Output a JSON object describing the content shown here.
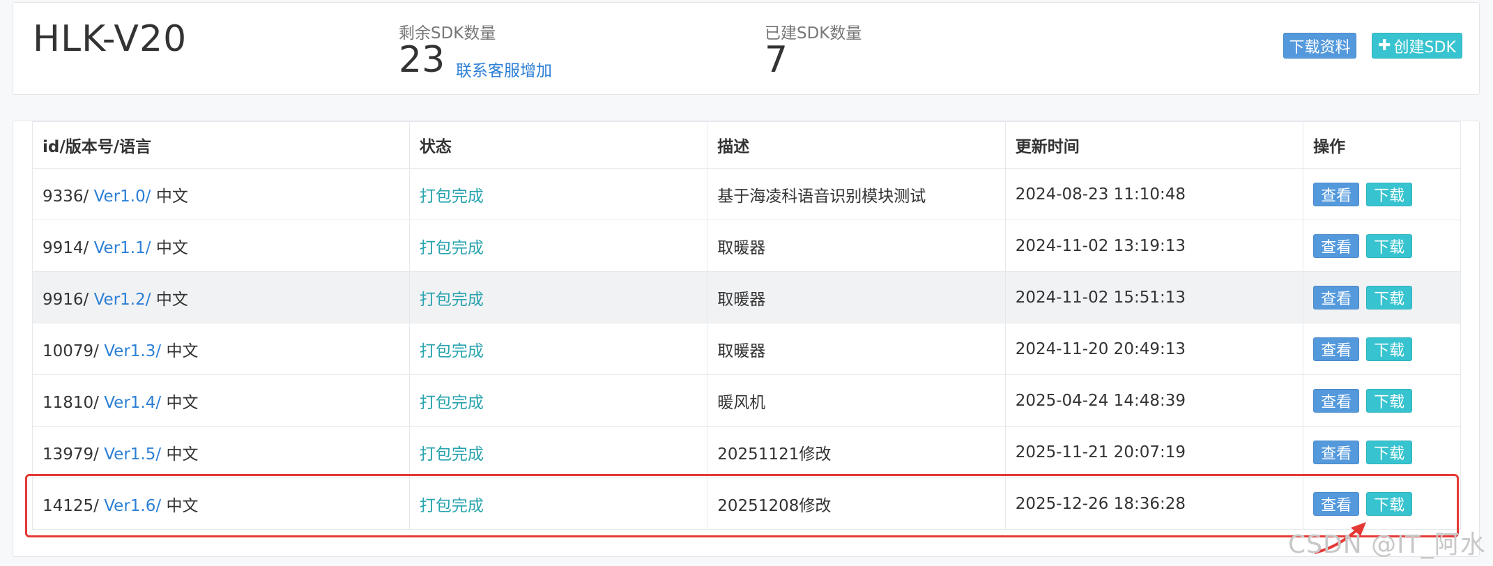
{
  "header": {
    "title": "HLK-V20",
    "remaining_label": "剩余SDK数量",
    "remaining_value": "23",
    "contact_link": "联系客服增加",
    "created_label": "已建SDK数量",
    "created_value": "7",
    "download_docs_label": "下载资料",
    "create_sdk_label": "创建SDK",
    "create_sdk_icon": "plus-icon"
  },
  "table": {
    "headers": [
      "id/版本号/语言",
      "状态",
      "描述",
      "更新时间",
      "操作"
    ],
    "rows": [
      {
        "id": "9336/",
        "version": "Ver1.0/",
        "lang": "中文",
        "status": "打包完成",
        "desc": "基于海凌科语音识别模块测试",
        "time": "2024-08-23 11:10:48",
        "view": "查看",
        "download": "下载"
      },
      {
        "id": "9914/",
        "version": "Ver1.1/",
        "lang": "中文",
        "status": "打包完成",
        "desc": "取暖器",
        "time": "2024-11-02 13:19:13",
        "view": "查看",
        "download": "下载"
      },
      {
        "id": "9916/",
        "version": "Ver1.2/",
        "lang": "中文",
        "status": "打包完成",
        "desc": "取暖器",
        "time": "2024-11-02 15:51:13",
        "view": "查看",
        "download": "下载"
      },
      {
        "id": "10079/",
        "version": "Ver1.3/",
        "lang": "中文",
        "status": "打包完成",
        "desc": "取暖器",
        "time": "2024-11-20 20:49:13",
        "view": "查看",
        "download": "下载"
      },
      {
        "id": "11810/",
        "version": "Ver1.4/",
        "lang": "中文",
        "status": "打包完成",
        "desc": "暖风机",
        "time": "2025-04-24 14:48:39",
        "view": "查看",
        "download": "下载"
      },
      {
        "id": "13979/",
        "version": "Ver1.5/",
        "lang": "中文",
        "status": "打包完成",
        "desc": "20251121修改",
        "time": "2025-11-21 20:07:19",
        "view": "查看",
        "download": "下载"
      },
      {
        "id": "14125/",
        "version": "Ver1.6/",
        "lang": "中文",
        "status": "打包完成",
        "desc": "20251208修改",
        "time": "2025-12-26 18:36:28",
        "view": "查看",
        "download": "下载"
      }
    ]
  },
  "watermark": "CSDN @IT_阿水",
  "colors": {
    "link": "#2b7fd6",
    "status": "#27a3ad",
    "btn_blue": "#5499dc",
    "btn_teal": "#37c3cf",
    "highlight": "#e53935"
  }
}
